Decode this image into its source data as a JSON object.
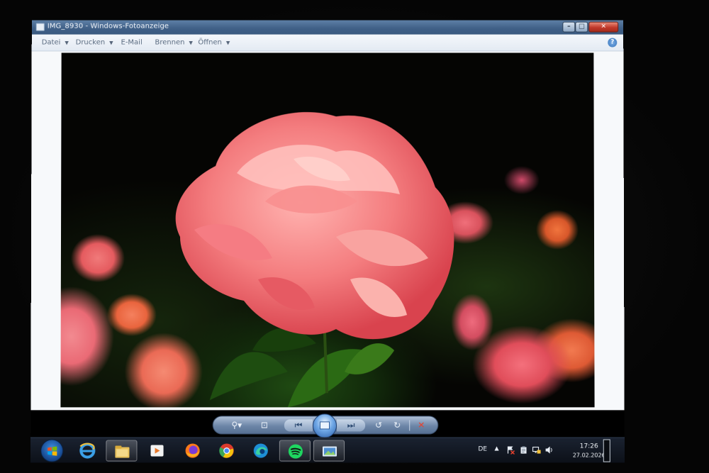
{
  "window": {
    "title": "IMG_8930 - Windows-Fotoanzeige",
    "min_glyph": "–",
    "max_glyph": "□",
    "close_glyph": "✕"
  },
  "menu": {
    "items": [
      {
        "label": "Datei",
        "has_arrow": true
      },
      {
        "label": "Drucken",
        "has_arrow": true
      },
      {
        "label": "E-Mail",
        "has_arrow": false
      },
      {
        "label": "Brennen",
        "has_arrow": true
      },
      {
        "label": "Öffnen",
        "has_arrow": true
      }
    ],
    "arrow_glyph": "▼",
    "help_glyph": "?"
  },
  "viewer_nav": {
    "zoom_glyph": "⚲▾",
    "fit_glyph": "⊡",
    "prev_glyph": "⏮",
    "next_glyph": "⏭",
    "rotate_left_glyph": "↺",
    "rotate_right_glyph": "↻",
    "delete_glyph": "✕"
  },
  "taskbar": {
    "apps": [
      {
        "name": "internet-explorer",
        "active": false
      },
      {
        "name": "file-explorer",
        "active": true
      },
      {
        "name": "media-player",
        "active": false
      },
      {
        "name": "firefox",
        "active": false
      },
      {
        "name": "chrome",
        "active": false
      },
      {
        "name": "edge",
        "active": false
      },
      {
        "name": "spotify",
        "active": true
      },
      {
        "name": "photo-viewer",
        "active": true
      }
    ]
  },
  "tray": {
    "language": "DE",
    "expand_glyph": "▲",
    "time": "17:26",
    "date": "27.02.2026"
  },
  "colors": {
    "taskbar_bg": "#0c1018",
    "titlebar": "#3f5f86",
    "close_button": "#c0392b",
    "rose": "#f06a6f"
  }
}
